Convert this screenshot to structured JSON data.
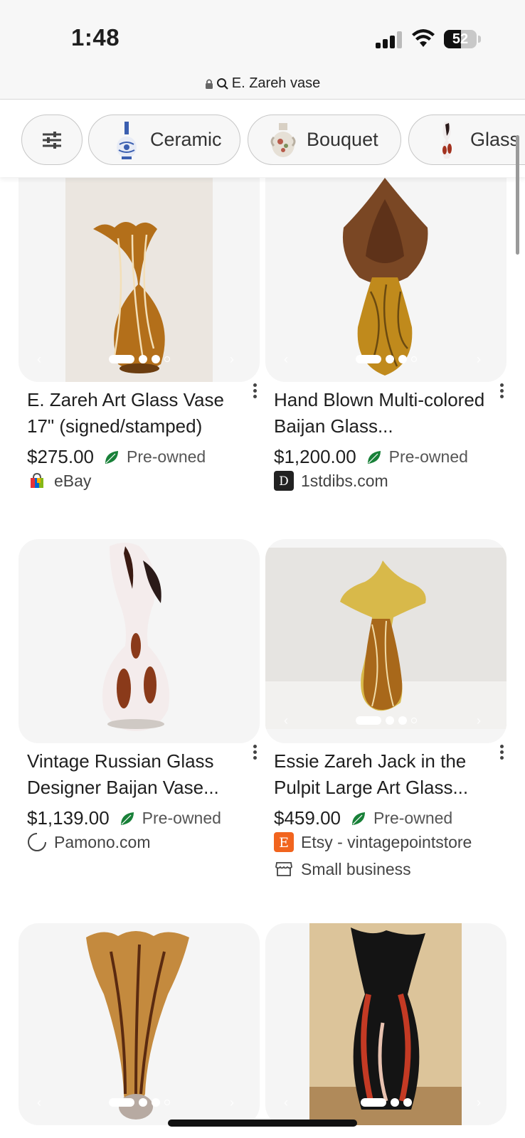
{
  "status": {
    "time": "1:48",
    "battery": "52"
  },
  "url_bar": {
    "query": "E. Zareh vase"
  },
  "chips": [
    {
      "label": "Ceramic"
    },
    {
      "label": "Bouquet"
    },
    {
      "label": "Glass"
    }
  ],
  "products": [
    {
      "title": "E. Zareh Art Glass Vase 17\" (signed/stamped)",
      "price": "$275.00",
      "condition": "Pre-owned",
      "merchant": "eBay"
    },
    {
      "title": "Hand Blown Multi-colored Baijan Glass...",
      "price": "$1,200.00",
      "condition": "Pre-owned",
      "merchant": "1stdibs.com"
    },
    {
      "title": "Vintage Russian Glass Designer Baijan Vase...",
      "price": "$1,139.00",
      "condition": "Pre-owned",
      "merchant": "Pamono.com"
    },
    {
      "title": "Essie Zareh Jack in the Pulpit Large Art Glass...",
      "price": "$459.00",
      "condition": "Pre-owned",
      "merchant": "Etsy - vintagepointstore",
      "badge": "Small business"
    }
  ],
  "colors": {
    "leaf": "#188038",
    "etsy": "#f1641e",
    "chip_bg": "#f7f7f7"
  }
}
